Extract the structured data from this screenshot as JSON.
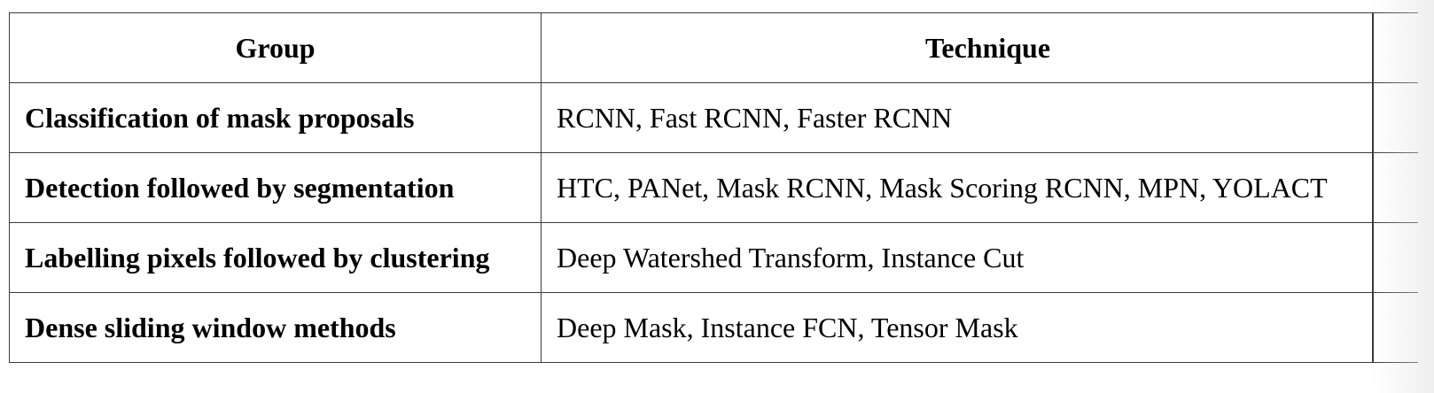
{
  "table": {
    "headers": {
      "group": "Group",
      "technique": "Technique"
    },
    "rows": [
      {
        "group": "Classification of mask proposals",
        "technique": "RCNN, Fast RCNN, Faster RCNN"
      },
      {
        "group": "Detection followed by segmentation",
        "technique": "HTC, PANet, Mask RCNN, Mask Scoring RCNN, MPN, YOLACT"
      },
      {
        "group": "Labelling pixels followed by clustering",
        "technique": "Deep Watershed Transform,  Instance Cut"
      },
      {
        "group": "Dense sliding window methods",
        "technique": "Deep Mask, Instance FCN, Tensor Mask"
      }
    ]
  }
}
